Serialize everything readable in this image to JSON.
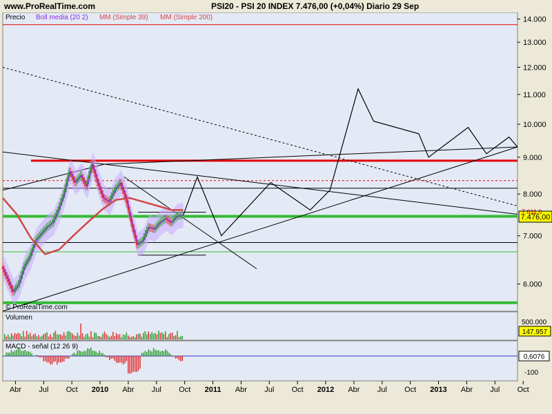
{
  "header": {
    "site": "www.ProRealTime.com",
    "title": "PSI20 - PSI 20 INDEX    7.476,00 (+0,04%)    Diario  29 Sep"
  },
  "legend": {
    "precio": "Precio",
    "boll": "Boll media (20 2)",
    "mm39": "MM (Simple 39)",
    "mm200": "MM (Simple 200)"
  },
  "watermark": "© ProRealTime.com",
  "panels": {
    "volume_label": "Volumen",
    "macd_label": "MACD - señal (12 26 9)"
  },
  "colors": {
    "background": "#e4eaf5",
    "candle_up": "#2e9e2e",
    "candle_down": "#e03030",
    "boll": "#c8a8ff",
    "mm39": "#8a2be2",
    "mm200": "#d04848",
    "support_green": "#33bb33",
    "resistance_red": "#e00000"
  },
  "chart_data": [
    {
      "type": "line",
      "panel": "price",
      "y_scale": "log",
      "ylim": [
        5.5,
        14.3
      ],
      "y_ticks": [
        "14.000",
        "13.000",
        "12.000",
        "11.000",
        "10.000",
        "9.000",
        "8.000",
        "7.000",
        "6.000"
      ],
      "x_ticks": [
        "Abr",
        "Jul",
        "Oct",
        "2010",
        "Abr",
        "Jul",
        "Oct",
        "2011",
        "Abr",
        "Jul",
        "Oct",
        "2012",
        "Abr",
        "Jul",
        "Oct",
        "2013",
        "Abr",
        "Jul",
        "Oct"
      ],
      "last_price": "7.476,00",
      "marker_price": "7.611,0",
      "series": [
        {
          "name": "Precio",
          "points": [
            [
              0.0,
              6.35
            ],
            [
              0.4,
              6.1
            ],
            [
              0.8,
              5.85
            ],
            [
              1.2,
              6.0
            ],
            [
              1.6,
              6.35
            ],
            [
              2.0,
              6.55
            ],
            [
              2.4,
              6.9
            ],
            [
              2.8,
              7.05
            ],
            [
              3.2,
              7.2
            ],
            [
              3.6,
              7.3
            ],
            [
              4.0,
              7.6
            ],
            [
              4.4,
              8.0
            ],
            [
              4.8,
              8.6
            ],
            [
              5.2,
              8.3
            ],
            [
              5.6,
              8.5
            ],
            [
              6.0,
              8.2
            ],
            [
              6.4,
              8.8
            ],
            [
              6.8,
              8.3
            ],
            [
              7.2,
              7.9
            ],
            [
              7.6,
              7.8
            ],
            [
              8.0,
              8.1
            ],
            [
              8.4,
              8.3
            ],
            [
              8.8,
              7.9
            ],
            [
              9.2,
              7.3
            ],
            [
              9.6,
              6.8
            ],
            [
              10.0,
              6.9
            ],
            [
              10.4,
              7.2
            ],
            [
              10.8,
              7.15
            ],
            [
              11.2,
              7.3
            ],
            [
              11.6,
              7.4
            ],
            [
              12.0,
              7.3
            ],
            [
              12.4,
              7.45
            ],
            [
              12.8,
              7.48
            ]
          ]
        },
        {
          "name": "MM (Simple 200)",
          "points": [
            [
              0.0,
              7.9
            ],
            [
              1.0,
              7.5
            ],
            [
              2.0,
              6.95
            ],
            [
              3.0,
              6.6
            ],
            [
              4.0,
              6.7
            ],
            [
              5.0,
              7.0
            ],
            [
              6.0,
              7.3
            ],
            [
              7.0,
              7.6
            ],
            [
              8.0,
              7.85
            ],
            [
              9.0,
              7.9
            ],
            [
              10.0,
              7.8
            ],
            [
              11.0,
              7.7
            ],
            [
              12.0,
              7.6
            ],
            [
              12.8,
              7.6
            ]
          ]
        }
      ],
      "projection": [
        [
          12.8,
          7.48
        ],
        [
          13.8,
          8.45
        ],
        [
          15.5,
          7.0
        ],
        [
          19.0,
          8.3
        ],
        [
          21.8,
          7.6
        ],
        [
          23.2,
          8.1
        ],
        [
          25.2,
          11.2
        ],
        [
          26.3,
          10.1
        ],
        [
          29.5,
          9.7
        ],
        [
          30.2,
          9.0
        ],
        [
          33.0,
          9.9
        ],
        [
          34.3,
          9.1
        ],
        [
          35.9,
          9.6
        ],
        [
          36.5,
          9.3
        ]
      ],
      "trend_lines": [
        {
          "style": "solid",
          "points": [
            [
              0.0,
              5.5
            ],
            [
              36.5,
              9.3
            ]
          ]
        },
        {
          "style": "solid",
          "points": [
            [
              0.0,
              8.1
            ],
            [
              7.2,
              8.8
            ],
            [
              36.5,
              9.3
            ]
          ]
        },
        {
          "style": "solid",
          "points": [
            [
              0.0,
              9.15
            ],
            [
              7.2,
              8.8
            ],
            [
              36.5,
              7.5
            ]
          ]
        },
        {
          "style": "solid",
          "points": [
            [
              8.6,
              8.45
            ],
            [
              18.0,
              6.3
            ]
          ]
        },
        {
          "style": "dashed",
          "points": [
            [
              0.0,
              12.0
            ],
            [
              36.5,
              7.7
            ]
          ]
        }
      ],
      "horizontal_levels": [
        {
          "value": 13.75,
          "color": "#e00000",
          "width": 1
        },
        {
          "value": 8.9,
          "color": "#e00000",
          "width": 3,
          "x_range": [
            2.0,
            36.5
          ]
        },
        {
          "value": 8.35,
          "color": "#e00000",
          "width": 1,
          "style": "dashed"
        },
        {
          "value": 8.15,
          "color": "#000000",
          "width": 1
        },
        {
          "value": 7.45,
          "color": "#33bb33",
          "width": 4
        },
        {
          "value": 6.85,
          "color": "#000000",
          "width": 1
        },
        {
          "value": 6.65,
          "color": "#33bb33",
          "width": 1
        },
        {
          "value": 5.65,
          "color": "#33bb33",
          "width": 4
        }
      ]
    },
    {
      "type": "bar",
      "panel": "volume",
      "last_value": "147.957",
      "y_ticks": [
        "500.000"
      ]
    },
    {
      "type": "bar",
      "panel": "macd",
      "last_value": "0,6076",
      "y_ticks": [
        "-100"
      ]
    }
  ]
}
